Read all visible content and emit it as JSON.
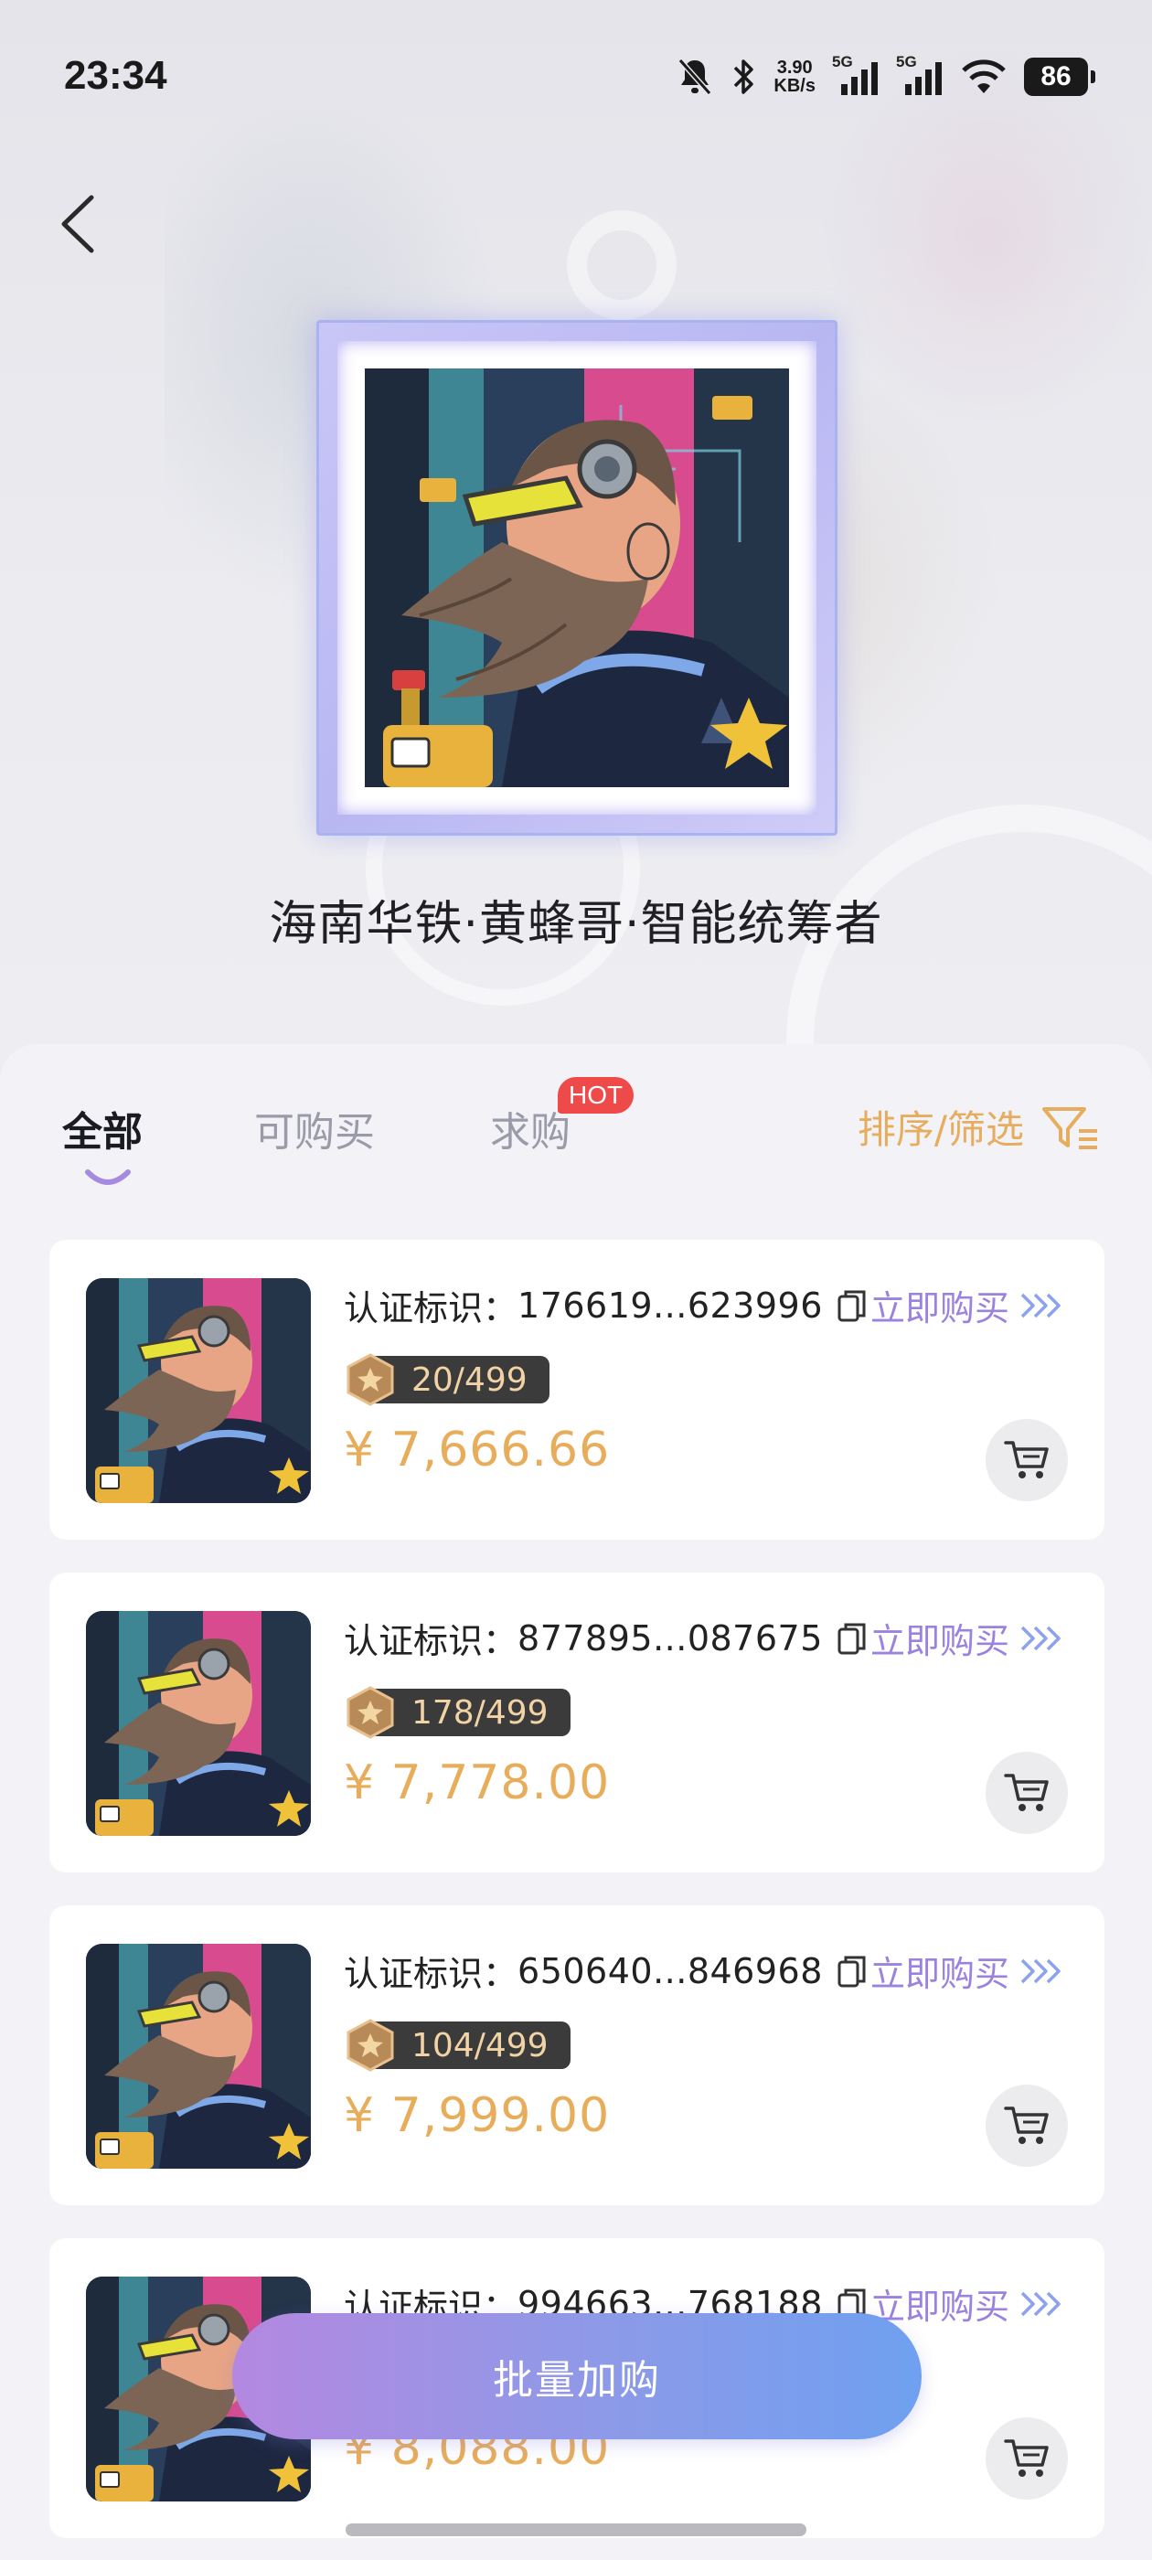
{
  "status_bar": {
    "time": "23:34",
    "net_speed_value": "3.90",
    "net_speed_unit": "KB/s",
    "sim1_label": "5G",
    "sim2_label": "5G",
    "battery": "86"
  },
  "header": {
    "collection_title": "海南华铁·黄蜂哥·智能统筹者"
  },
  "tabs": [
    {
      "label": "全部",
      "active": true
    },
    {
      "label": "可购买",
      "active": false
    },
    {
      "label": "求购",
      "active": false
    }
  ],
  "hot_badge": "HOT",
  "sort_filter_label": "排序/筛选",
  "cert_prefix": "认证标识：",
  "buy_label": "立即购买",
  "listings": [
    {
      "cert_id": "176619...623996",
      "edition": "20/499",
      "price": "¥ 7,666.66"
    },
    {
      "cert_id": "877895...087675",
      "edition": "178/499",
      "price": "¥ 7,778.00"
    },
    {
      "cert_id": "650640...846968",
      "edition": "104/499",
      "price": "¥ 7,999.00"
    },
    {
      "cert_id": "994663...768188",
      "edition": "",
      "price": "¥ 8,088.00"
    }
  ],
  "batch_button_label": "批量加购",
  "colors": {
    "accent_purple": "#9b82de",
    "price_gold": "#e8ad5b",
    "hot_red": "#ee4a4a",
    "edition_bg": "#3c3b3b"
  }
}
